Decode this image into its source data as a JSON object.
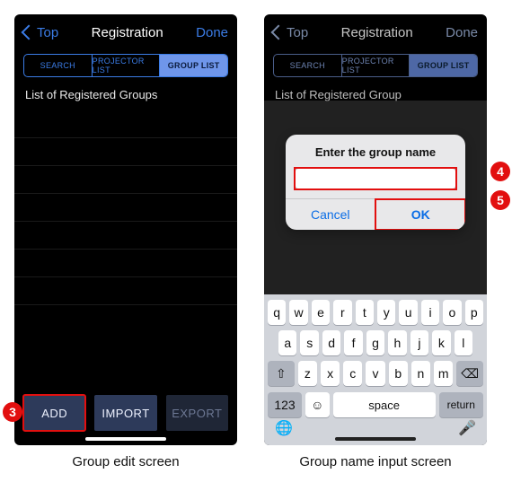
{
  "markers": {
    "m3": "3",
    "m4": "4",
    "m5": "5"
  },
  "captions": {
    "left": "Group edit screen",
    "right": "Group name input screen"
  },
  "left": {
    "nav": {
      "back": "Top",
      "title": "Registration",
      "done": "Done"
    },
    "tabs": {
      "search": "SEARCH",
      "plist": "PROJECTOR LIST",
      "glist": "GROUP LIST"
    },
    "list_title": "List of Registered Groups",
    "actions": {
      "add": "ADD",
      "import": "IMPORT",
      "export": "EXPORT"
    }
  },
  "right": {
    "nav": {
      "back": "Top",
      "title": "Registration",
      "done": "Done"
    },
    "tabs": {
      "search": "SEARCH",
      "plist": "PROJECTOR LIST",
      "glist": "GROUP LIST"
    },
    "list_title": "List of Registered Group",
    "dialog": {
      "title": "Enter the group name",
      "input_value": "",
      "cancel": "Cancel",
      "ok": "OK"
    },
    "keyboard": {
      "row1": [
        "q",
        "w",
        "e",
        "r",
        "t",
        "y",
        "u",
        "i",
        "o",
        "p"
      ],
      "row2": [
        "a",
        "s",
        "d",
        "f",
        "g",
        "h",
        "j",
        "k",
        "l"
      ],
      "row3": [
        "z",
        "x",
        "c",
        "v",
        "b",
        "n",
        "m"
      ],
      "shift": "⇧",
      "back": "⌫",
      "num": "123",
      "emoji": "☺",
      "space": "space",
      "return": "return",
      "globe": "🌐",
      "mic": "🎤"
    }
  }
}
